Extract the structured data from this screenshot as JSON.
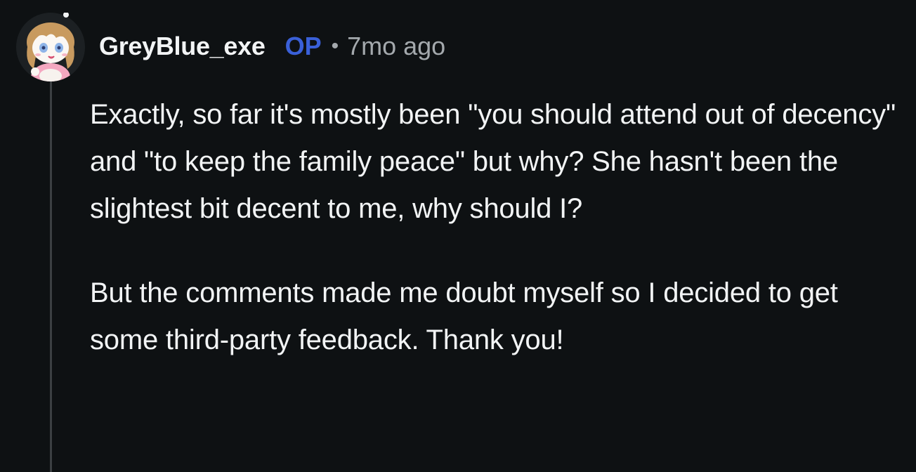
{
  "comment": {
    "author": "GreyBlue_exe",
    "op_badge": "OP",
    "separator": "•",
    "timestamp": "7mo ago",
    "paragraphs": [
      "Exactly, so far it's mostly been \"you should attend out of decency\" and \"to keep the family peace\" but why? She hasn't been the slightest bit decent to me, why should I?",
      "But the comments made me doubt myself so I decided to get some third-party feedback. Thank you!"
    ]
  },
  "colors": {
    "background": "#0e1113",
    "text": "#f2f4f5",
    "meta": "#a4a9ad",
    "op_badge": "#3a60d8",
    "thread_line": "#3b3f42"
  },
  "icons": {
    "avatar": "user-avatar-snoo"
  }
}
